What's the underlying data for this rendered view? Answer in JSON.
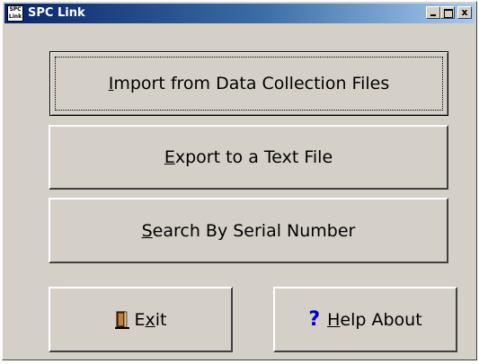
{
  "window": {
    "title": "SPC Link",
    "icon_text": [
      "SPC",
      "Link"
    ],
    "controls": {
      "minimize": "_",
      "maximize": "□",
      "close": "x"
    }
  },
  "buttons": {
    "import": {
      "prefix": "",
      "accel": "I",
      "rest": "mport from Data Collection Files"
    },
    "export": {
      "prefix": "",
      "accel": "E",
      "rest": "xport to a Text File"
    },
    "search": {
      "prefix": "",
      "accel": "S",
      "rest": "earch By Serial Number"
    },
    "exit": {
      "prefix": "E",
      "accel": "x",
      "rest": "it",
      "icon": "door-exit-icon"
    },
    "help": {
      "prefix": "",
      "accel": "H",
      "rest": "elp About",
      "icon_glyph": "?"
    }
  },
  "colors": {
    "face": "#d4d0c8",
    "titlebar_start": "#0a246a",
    "titlebar_end": "#a6caf0",
    "help_icon": "#0000c8"
  }
}
